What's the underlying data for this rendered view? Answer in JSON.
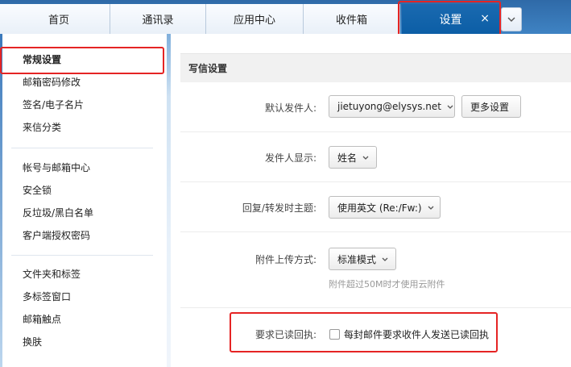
{
  "tabs": [
    {
      "label": "首页"
    },
    {
      "label": "通讯录"
    },
    {
      "label": "应用中心"
    },
    {
      "label": "收件箱"
    }
  ],
  "active_tab": {
    "label": "设置",
    "close": "×"
  },
  "sidebar": {
    "groups": [
      {
        "items": [
          {
            "label": "常规设置",
            "active": true
          },
          {
            "label": "邮箱密码修改"
          },
          {
            "label": "签名/电子名片"
          },
          {
            "label": "来信分类"
          }
        ]
      },
      {
        "items": [
          {
            "label": "帐号与邮箱中心"
          },
          {
            "label": "安全锁"
          },
          {
            "label": "反垃圾/黑白名单"
          },
          {
            "label": "客户端授权密码"
          }
        ]
      },
      {
        "items": [
          {
            "label": "文件夹和标签"
          },
          {
            "label": "多标签窗口"
          },
          {
            "label": "邮箱触点"
          },
          {
            "label": "换肤"
          }
        ]
      }
    ]
  },
  "main": {
    "section_title": "写信设置",
    "default_sender": {
      "label": "默认发件人:",
      "value": "jietuyong@elysys.net",
      "more_button": "更多设置"
    },
    "sender_display": {
      "label": "发件人显示:",
      "value": "姓名"
    },
    "reply_subject": {
      "label": "回复/转发时主题:",
      "value": "使用英文 (Re:/Fw:)"
    },
    "upload_mode": {
      "label": "附件上传方式:",
      "value": "标准模式",
      "hint": "附件超过50M时才使用云附件"
    },
    "read_receipt": {
      "label": "要求已读回执:",
      "checkbox_label": "每封邮件要求收件人发送已读回执",
      "checked": false
    }
  },
  "colors": {
    "accent": "#0c5ea6",
    "highlight": "#e52424"
  }
}
